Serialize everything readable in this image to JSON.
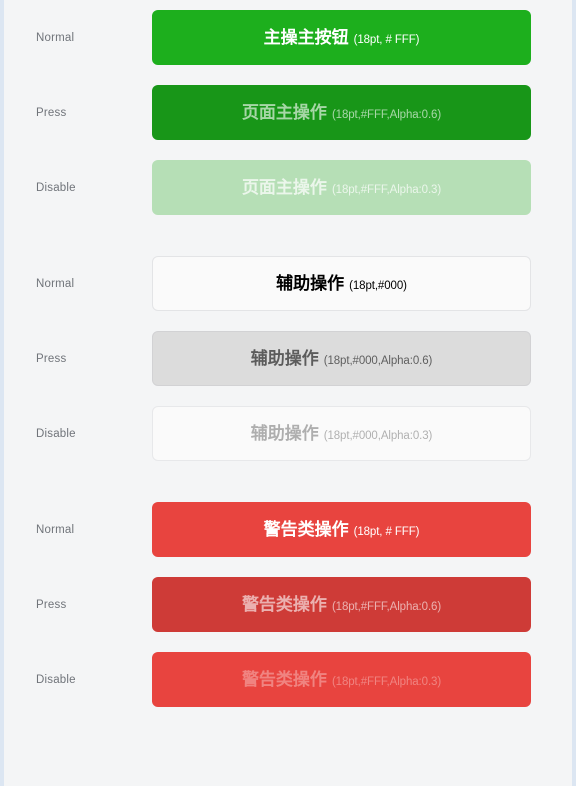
{
  "colors": {
    "page_edge": "#DCE6F2",
    "card_background": "#F4F5F6",
    "primary_normal": "#1DAF1D",
    "primary_press": "#189618",
    "primary_disable": "#B6DFB6",
    "secondary_normal": "#FAFAFA",
    "secondary_press": "#DCDCDC",
    "secondary_disable": "#FAFAFA",
    "warning_normal": "#E8443F",
    "warning_press": "#CE3B37",
    "warning_disable": "#E8443F",
    "row_label": "#70747A"
  },
  "groups": [
    {
      "name": "primary",
      "rows": [
        {
          "state_label": "Normal",
          "button_label": "主操主按钮",
          "button_note": "(18pt, # FFF)"
        },
        {
          "state_label": "Press",
          "button_label": "页面主操作",
          "button_note": "(18pt,#FFF,Alpha:0.6)"
        },
        {
          "state_label": "Disable",
          "button_label": "页面主操作",
          "button_note": "(18pt,#FFF,Alpha:0.3)"
        }
      ]
    },
    {
      "name": "secondary",
      "rows": [
        {
          "state_label": "Normal",
          "button_label": "辅助操作",
          "button_note": "(18pt,#000)"
        },
        {
          "state_label": "Press",
          "button_label": "辅助操作",
          "button_note": "(18pt,#000,Alpha:0.6)"
        },
        {
          "state_label": "Disable",
          "button_label": "辅助操作",
          "button_note": "(18pt,#000,Alpha:0.3)"
        }
      ]
    },
    {
      "name": "warning",
      "rows": [
        {
          "state_label": "Normal",
          "button_label": "警告类操作",
          "button_note": "(18pt, # FFF)"
        },
        {
          "state_label": "Press",
          "button_label": "警告类操作",
          "button_note": "(18pt,#FFF,Alpha:0.6)"
        },
        {
          "state_label": "Disable",
          "button_label": "警告类操作",
          "button_note": "(18pt,#FFF,Alpha:0.3)"
        }
      ]
    }
  ]
}
